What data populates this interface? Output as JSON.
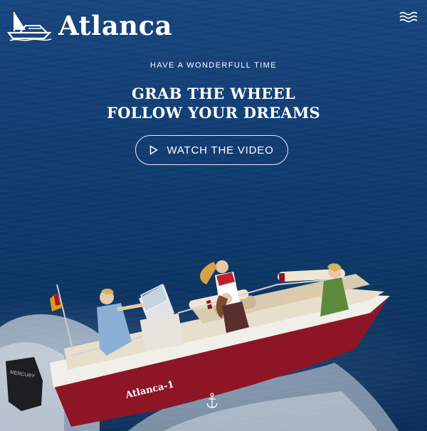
{
  "brand": {
    "name": "Atlanca",
    "logo_icon": "yacht-logo-icon"
  },
  "nav": {
    "menu_icon": "waves-menu-icon"
  },
  "hero": {
    "tagline": "HAVE A WONDERFULL TIME",
    "headline_line1": "GRAB THE WHEEL",
    "headline_line2": "FOLLOW YOUR DREAMS",
    "cta_label": "WATCH THE VIDEO",
    "cta_icon": "play-icon",
    "boat_name": "Atlanca-1",
    "motor_brand": "MERCURY",
    "scroll_icon": "anchor-icon"
  },
  "colors": {
    "sea": "#123d73",
    "text": "#ffffff",
    "hull_accent": "#8e1526"
  }
}
